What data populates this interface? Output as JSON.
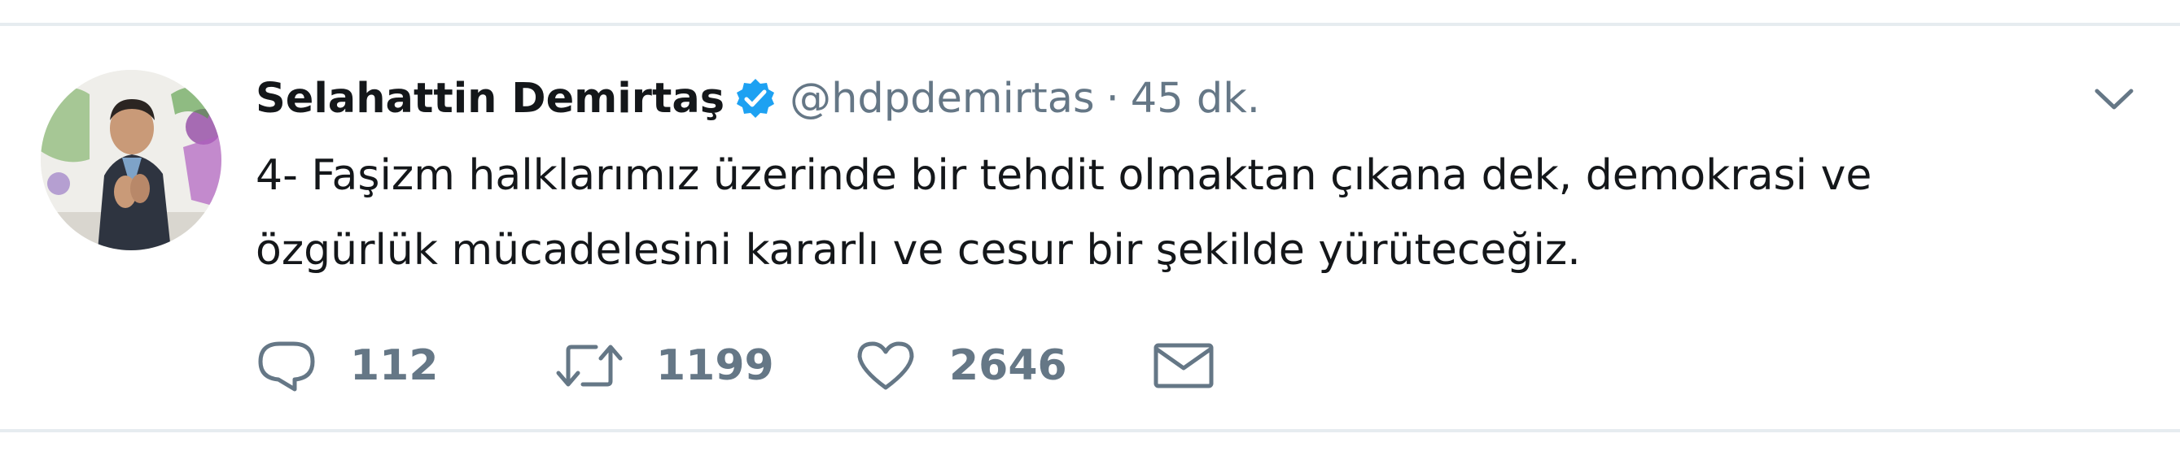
{
  "tweet": {
    "author": {
      "name": "Selahattin Demirtaş",
      "handle": "@hdpdemirtas",
      "separator": "·",
      "time": "45 dk.",
      "verified": true
    },
    "text_lines": [
      "4- Faşizm halklarımız üzerinde bir tehdit olmaktan çıkana dek, demokrasi ve",
      "özgürlük mücadelesini kararlı ve cesur bir şekilde yürüteceğiz."
    ],
    "actions": {
      "reply": {
        "icon": "reply-icon",
        "count": "112"
      },
      "retweet": {
        "icon": "retweet-icon",
        "count": "1199"
      },
      "like": {
        "icon": "heart-icon",
        "count": "2646"
      },
      "message": {
        "icon": "envelope-icon"
      }
    },
    "menu_icon": "chevron-down-icon"
  },
  "colors": {
    "text": "#14171a",
    "secondary": "#657786",
    "verified_blue": "#1da1f2",
    "border": "#e6ecf0"
  }
}
